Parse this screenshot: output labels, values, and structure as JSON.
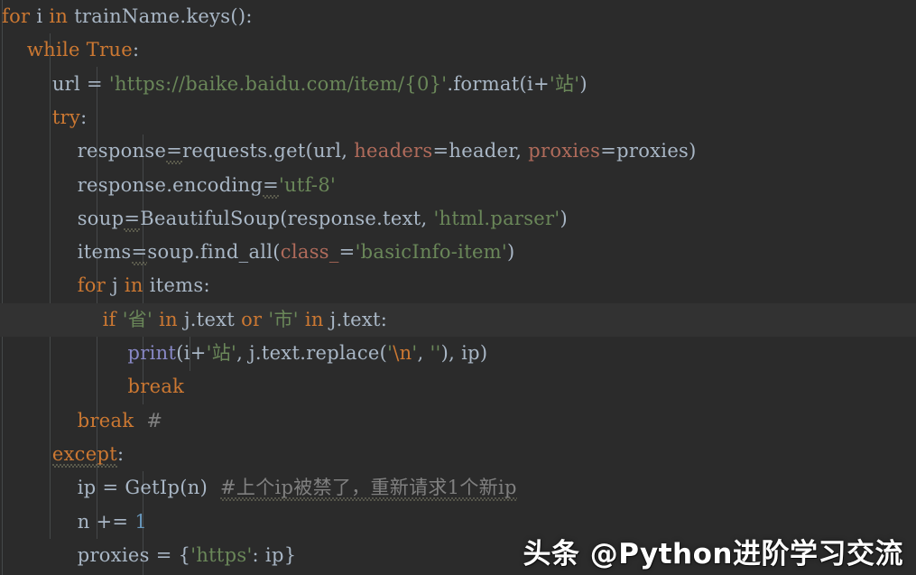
{
  "editor": {
    "language": "python",
    "theme": "darcula",
    "background_color": "#2b2b2b",
    "current_line_color": "#323232",
    "indent_guide_color": "#4a4d4f",
    "default_text_color": "#a9b7c6",
    "keyword_color": "#cc7832",
    "string_color": "#6a8759",
    "number_color": "#6897bb",
    "builtin_func_color": "#8888c6",
    "kwarg_color": "#b06b5b",
    "comment_color": "#808080",
    "indent_guide_x": [
      2,
      55,
      107,
      158,
      210
    ],
    "current_line_index": 9
  },
  "code": {
    "lines": [
      {
        "indent": 0,
        "text": "for i in trainName.keys():"
      },
      {
        "indent": 1,
        "text": "while True:"
      },
      {
        "indent": 2,
        "text": "url = 'https://baike.baidu.com/item/{0}'.format(i+'站')"
      },
      {
        "indent": 2,
        "text": "try:"
      },
      {
        "indent": 3,
        "text": "response=requests.get(url, headers=header, proxies=proxies)"
      },
      {
        "indent": 3,
        "text": "response.encoding='utf-8'"
      },
      {
        "indent": 3,
        "text": "soup=BeautifulSoup(response.text, 'html.parser')"
      },
      {
        "indent": 3,
        "text": "items=soup.find_all(class_='basicInfo-item')"
      },
      {
        "indent": 3,
        "text": "for j in items:"
      },
      {
        "indent": 4,
        "text": "if '省' in j.text or '市' in j.text:"
      },
      {
        "indent": 5,
        "text": "print(i+'站', j.text.replace('\\n', ''), ip)"
      },
      {
        "indent": 5,
        "text": "break"
      },
      {
        "indent": 3,
        "text": "break  #"
      },
      {
        "indent": 2,
        "text": "except:"
      },
      {
        "indent": 3,
        "text": "ip = GetIp(n)  #上个ip被禁了，重新请求1个新ip"
      },
      {
        "indent": 3,
        "text": "n += 1"
      },
      {
        "indent": 3,
        "text": "proxies = {'https': ip}"
      }
    ],
    "inline_comment_1": "#",
    "inline_comment_2": "#上个ip被禁了，重新请求1个新ip",
    "url_string": "'https://baike.baidu.com/item/{0}'",
    "encoding_string": "'utf-8'",
    "parser_string": "'html.parser'",
    "css_class_string": "'basicInfo-item'",
    "station_string": "'站'",
    "province_string": "'省'",
    "city_string": "'市'",
    "newline_escape": "'\\n'",
    "empty_string": "''",
    "https_key_string": "'https'"
  },
  "watermark": {
    "text": "头条 @Python进阶学习交流",
    "color": "#ffffff"
  }
}
